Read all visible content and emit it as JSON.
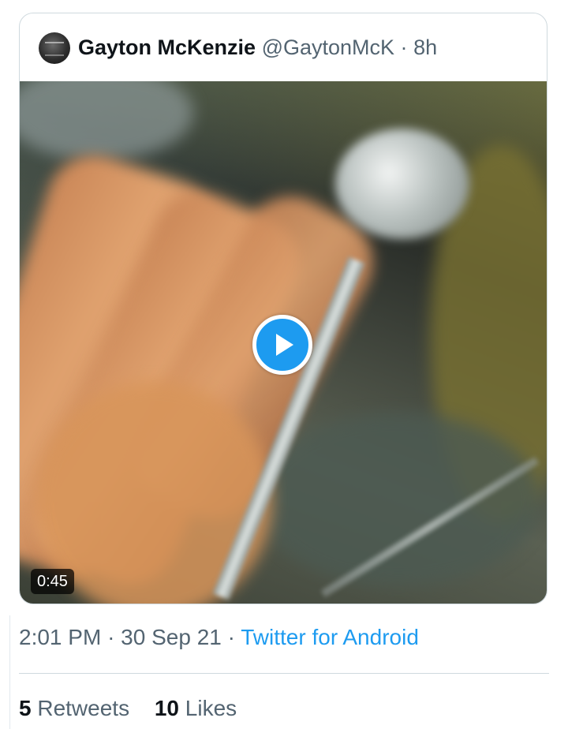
{
  "quote": {
    "display_name": "Gayton McKenzie",
    "handle": "@GaytonMcK",
    "separator": "·",
    "age": "8h",
    "video": {
      "duration": "0:45"
    }
  },
  "tweet": {
    "time": "2:01 PM",
    "separator": "·",
    "date": "30 Sep 21",
    "source_separator": "·",
    "source": "Twitter for Android"
  },
  "stats": {
    "retweets_count": "5",
    "retweets_label": "Retweets",
    "likes_count": "10",
    "likes_label": "Likes"
  },
  "colors": {
    "accent": "#1d9bf0",
    "text_primary": "#0f1419",
    "text_secondary": "#536471",
    "border": "#cfd9de"
  },
  "icons": {
    "play": "play-icon",
    "avatar": "avatar"
  }
}
